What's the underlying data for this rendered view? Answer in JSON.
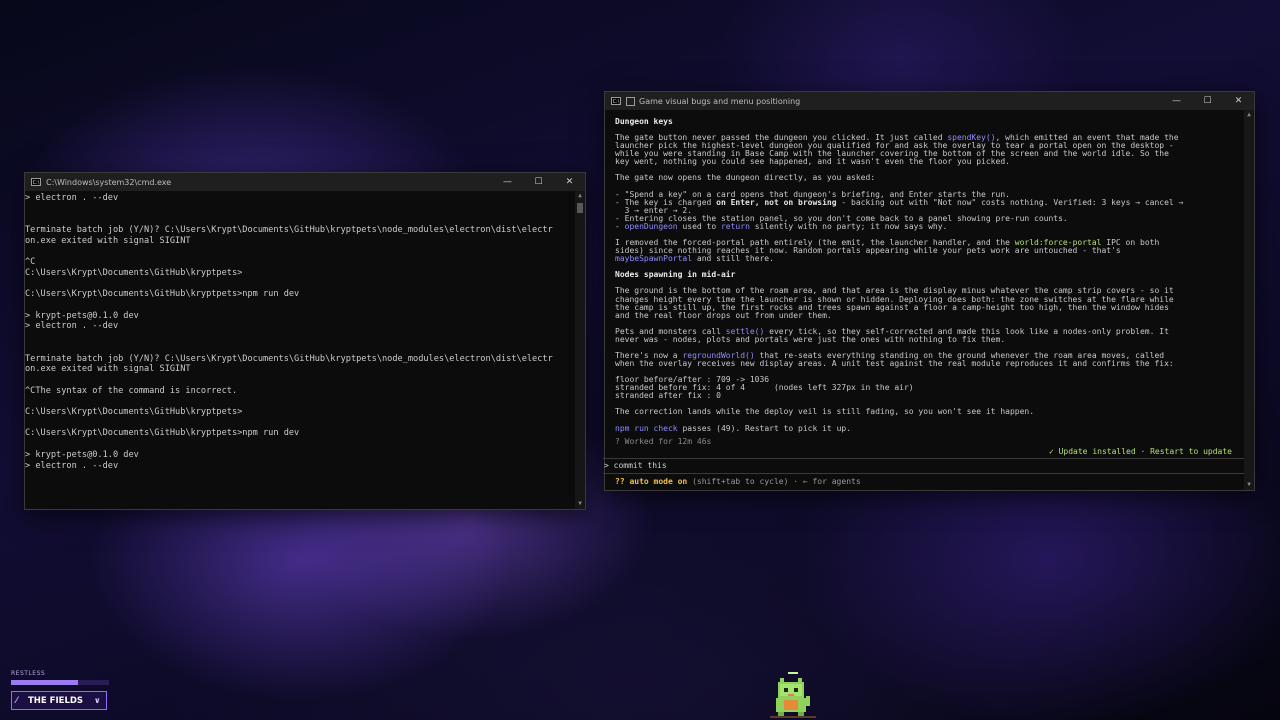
{
  "cmd_window": {
    "title": "C:\\Windows\\system32\\cmd.exe",
    "controls": [
      "—",
      "☐",
      "✕"
    ],
    "lines": [
      "> electron . --dev",
      "",
      "",
      "Terminate batch job (Y/N)? C:\\Users\\Krypt\\Documents\\GitHub\\kryptpets\\node_modules\\electron\\dist\\electr",
      "on.exe exited with signal SIGINT",
      "",
      "^C",
      "C:\\Users\\Krypt\\Documents\\GitHub\\kryptpets>",
      "",
      "C:\\Users\\Krypt\\Documents\\GitHub\\kryptpets>npm run dev",
      "",
      "> krypt-pets@0.1.0 dev",
      "> electron . --dev",
      "",
      "",
      "Terminate batch job (Y/N)? C:\\Users\\Krypt\\Documents\\GitHub\\kryptpets\\node_modules\\electron\\dist\\electr",
      "on.exe exited with signal SIGINT",
      "",
      "^CThe syntax of the command is incorrect.",
      "",
      "C:\\Users\\Krypt\\Documents\\GitHub\\kryptpets>",
      "",
      "C:\\Users\\Krypt\\Documents\\GitHub\\kryptpets>npm run dev",
      "",
      "> krypt-pets@0.1.0 dev",
      "> electron . --dev"
    ]
  },
  "term_window": {
    "title": "Game visual bugs and menu positioning",
    "controls": [
      "—",
      "☐",
      "✕"
    ],
    "h1": "Dungeon keys",
    "p1": {
      "a": "The gate button never passed the dungeon you clicked. It just called ",
      "fn": "spendKey()",
      "b": ", which emitted an event that made the\nlauncher pick the highest-level dungeon you qualified for and ask the overlay to tear a portal open on the desktop -\nwhile you were standing in Base Camp with the launcher covering the bottom of the screen and the world idle. So the\nkey went, nothing you could see happened, and it wasn't even the floor you picked."
    },
    "p2": "The gate now opens the dungeon directly, as you asked:",
    "bullets": {
      "b1": "- \"Spend a key\" on a card opens that dungeon's briefing, and Enter starts the run.",
      "b2a": "- The key is charged ",
      "b2bold": "on Enter, not on browsing",
      "b2b": " - backing out with \"Not now\" costs nothing. Verified: 3 keys → cancel →\n  3 → enter → 2.",
      "b3": "- Entering closes the station panel, so you don't come back to a panel showing pre-run counts.",
      "b4dash": "- ",
      "b4fn": "openDungeon",
      "b4mid": " used to ",
      "b4fn2": "return",
      "b4end": " silently with no party; it now says why."
    },
    "p3": {
      "a": "I removed the forced-portal path entirely (the emit, the launcher handler, and the ",
      "fn": "world:force-portal",
      "b": " IPC on both\nsides) since nothing reaches it now. Random portals appearing while your pets work are untouched - that's\n",
      "fn2": "maybeSpawnPortal",
      "c": " and still there."
    },
    "h2": "Nodes spawning in mid-air",
    "p4": "The ground is the bottom of the roam area, and that area is the display minus whatever the camp strip covers - so it\nchanges height every time the launcher is shown or hidden. Deploying does both: the zone switches at the flare while\nthe camp is still up, the first rocks and trees spawn against a floor a camp-height too high, then the window hides\nand the real floor drops out from under them.",
    "p5": {
      "a": "Pets and monsters call ",
      "fn": "settle()",
      "b": " every tick, so they self-corrected and made this look like a nodes-only problem. It\nnever was - nodes, plots and portals were just the ones with nothing to fix them."
    },
    "p6": {
      "a": "There's now a ",
      "fn": "regroundWorld()",
      "b": " that re-seats everything standing on the ground whenever the roam area moves, called\nwhen the overlay receives new display areas. A unit test against the real module reproduces it and confirms the fix:"
    },
    "code": "floor before/after : 709 -> 1036\nstranded before fix: 4 of 4      (nodes left 327px in the air)\nstranded after fix : 0",
    "p7": "The correction lands while the deploy veil is still fading, so you won't see it happen.",
    "p8": {
      "cmd": "npm run check",
      "b": " passes (49). Restart to pick it up."
    },
    "worked": "? Worked for 12m 46s",
    "update": "✓ Update installed · Restart to update",
    "prompt_char": ">",
    "input": "commit this",
    "automode_prefix": "?? auto mode on",
    "automode_rest": " (shift+tab to cycle) · ← for agents"
  },
  "hud": {
    "status_label": "RESTLESS",
    "status_level": 0.68,
    "zone_button": "THE FIELDS",
    "zone_icon": "flare-icon",
    "chevron": "∨"
  },
  "colors": {
    "accent_purple": "#8f6bff",
    "function_highlight": "#8f8cff",
    "green": "#b6e072",
    "automode_yellow": "#f0c040"
  }
}
